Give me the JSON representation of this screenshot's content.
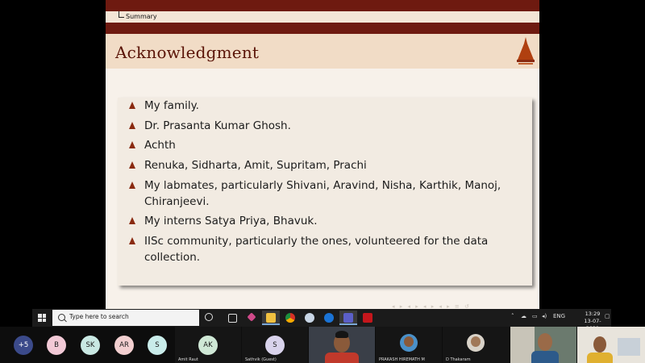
{
  "slide": {
    "breadcrumb": "Summary",
    "title": "Acknowledgment",
    "bullets": [
      "My family.",
      "Dr. Prasanta Kumar Ghosh.",
      "Achth",
      "Renuka, Sidharta, Amit, Supritam, Prachi",
      "My labmates, particularly Shivani, Aravind, Nisha, Karthik, Manoj, Chiranjeevi.",
      "My interns Satya Priya, Bhavuk.",
      "IISc community, particularly the ones, volunteered for the data collection."
    ],
    "accent_color": "#6e1a10"
  },
  "taskbar": {
    "search_placeholder": "Type here to search",
    "language": "ENG",
    "time": "13:29",
    "date": "13-07-2021",
    "icons": [
      "cortana-icon",
      "task-view-icon",
      "app-icon",
      "file-explorer-icon",
      "chrome-icon",
      "app-icon-2",
      "teamviewer-icon",
      "teams-icon",
      "acrobat-icon"
    ]
  },
  "participants": {
    "overflow_count": "+5",
    "avatars": [
      {
        "initials": "B",
        "color": "#f2c9d6"
      },
      {
        "initials": "SK",
        "color": "#c9e8e3"
      },
      {
        "initials": "AR",
        "color": "#f2cfd0"
      },
      {
        "initials": "S",
        "color": "#c9ecea"
      },
      {
        "initials": "AK",
        "color": "#cfe8d6",
        "name": "Amit Raut"
      },
      {
        "initials": "S",
        "color": "#d9d3ec",
        "name": "Sathvik (Guest)"
      }
    ],
    "video_names": [
      "PRAKASH HIREMATH M",
      "D Thakaram"
    ]
  }
}
